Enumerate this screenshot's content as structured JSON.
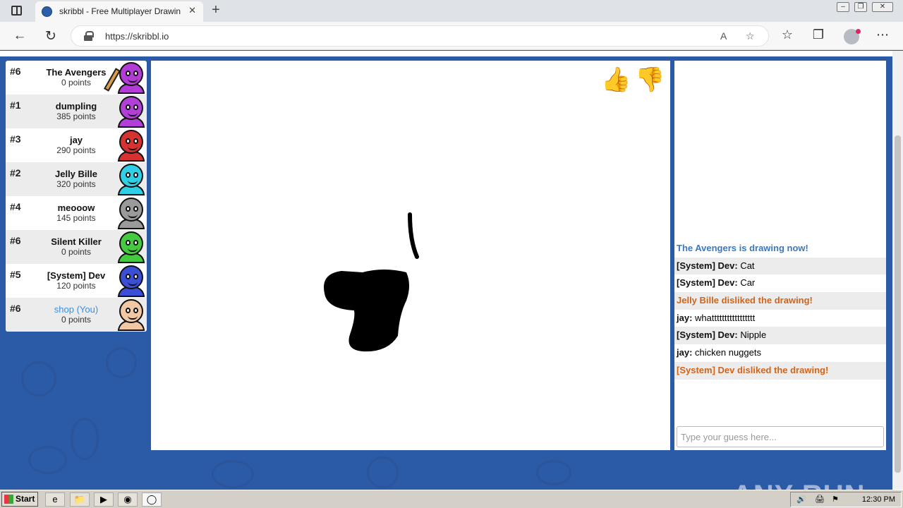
{
  "browser": {
    "tab_title": "skribbl - Free Multiplayer Drawing",
    "tab_close": "✕",
    "new_tab": "+",
    "url": "https://skribbl.io",
    "read_aloud": "A",
    "window_controls": [
      "–",
      "❐",
      "✕"
    ]
  },
  "game": {
    "word_hint": "_______ ______",
    "players": [
      {
        "rank": "#6",
        "name": "The Avengers",
        "points": "0 points",
        "color": "#b33cd6",
        "drawing": true,
        "you": false
      },
      {
        "rank": "#1",
        "name": "dumpling",
        "points": "385 points",
        "color": "#b23fd8",
        "drawing": false,
        "you": false
      },
      {
        "rank": "#3",
        "name": "jay",
        "points": "290 points",
        "color": "#d63232",
        "drawing": false,
        "you": false
      },
      {
        "rank": "#2",
        "name": "Jelly Bille",
        "points": "320 points",
        "color": "#2fd0e6",
        "drawing": false,
        "you": false
      },
      {
        "rank": "#4",
        "name": "meooow",
        "points": "145 points",
        "color": "#9a9a9a",
        "drawing": false,
        "you": false
      },
      {
        "rank": "#6",
        "name": "Silent Killer",
        "points": "0 points",
        "color": "#45c93e",
        "drawing": false,
        "you": false
      },
      {
        "rank": "#5",
        "name": "[System] Dev",
        "points": "120 points",
        "color": "#3a4fd6",
        "drawing": false,
        "you": false
      },
      {
        "rank": "#6",
        "name": "shop (You)",
        "points": "0 points",
        "color": "#f1c8a3",
        "drawing": false,
        "you": true
      }
    ],
    "like_icon": "thumbs-up-icon",
    "dislike_icon": "thumbs-down-icon"
  },
  "chat": {
    "messages": [
      {
        "type": "system-blue",
        "text": "The Avengers is drawing now!"
      },
      {
        "type": "chat",
        "author": "[System] Dev:",
        "text": " Cat"
      },
      {
        "type": "chat",
        "author": "[System] Dev:",
        "text": " Car"
      },
      {
        "type": "system-orange",
        "text": "Jelly Bille disliked the drawing!"
      },
      {
        "type": "chat",
        "author": "jay:",
        "text": " whattttttttttttttttt"
      },
      {
        "type": "chat",
        "author": "[System] Dev:",
        "text": " Nipple"
      },
      {
        "type": "chat",
        "author": "jay:",
        "text": " chicken nuggets"
      },
      {
        "type": "system-orange",
        "text": "[System] Dev disliked the drawing!"
      }
    ],
    "input_placeholder": "Type your guess here..."
  },
  "watermark": "ANY RUN",
  "taskbar": {
    "start_label": "Start",
    "clock": "12:30 PM"
  }
}
